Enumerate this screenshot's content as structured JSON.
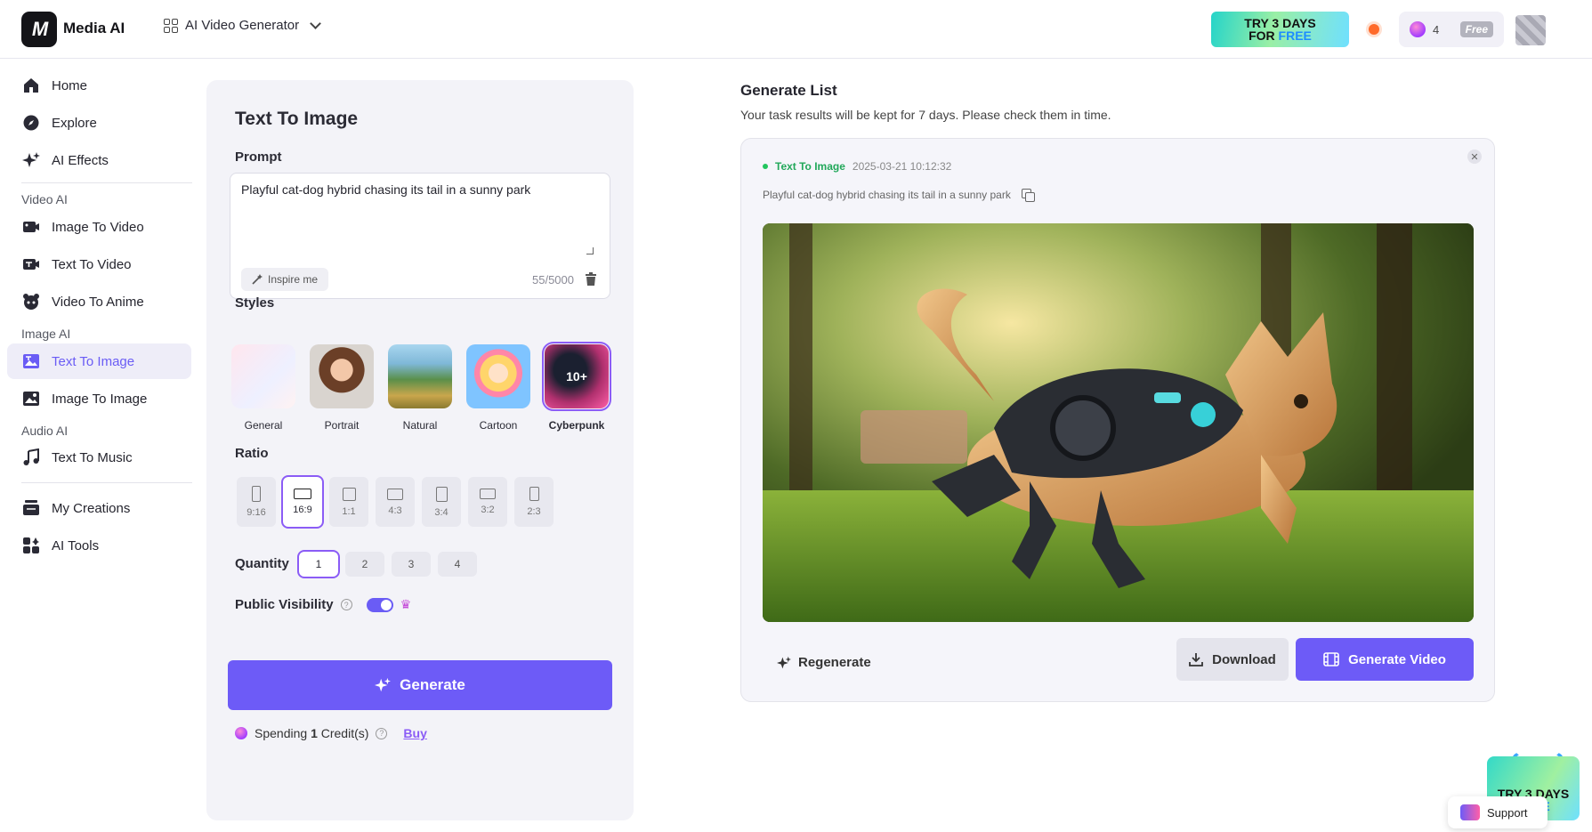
{
  "header": {
    "logo_text": "M",
    "brand": "Media AI",
    "app_switch": "AI Video Generator",
    "promo_line1": "TRY 3 DAYS",
    "promo_line2a": "FOR ",
    "promo_line2b": "FREE",
    "credits": "4",
    "free_badge": "Free"
  },
  "sidebar": {
    "items": [
      {
        "label": "Home",
        "icon": "home-icon"
      },
      {
        "label": "Explore",
        "icon": "compass-icon"
      },
      {
        "label": "AI Effects",
        "icon": "sparkle-icon"
      },
      {
        "label": "Image To Video",
        "icon": "image-video-icon"
      },
      {
        "label": "Text To Video",
        "icon": "text-video-icon"
      },
      {
        "label": "Video To Anime",
        "icon": "anime-icon"
      },
      {
        "label": "Text To Image",
        "icon": "text-image-icon",
        "active": true
      },
      {
        "label": "Image To Image",
        "icon": "image-image-icon"
      },
      {
        "label": "Text To Music",
        "icon": "music-icon"
      },
      {
        "label": "My Creations",
        "icon": "stack-icon"
      },
      {
        "label": "AI Tools",
        "icon": "tools-icon"
      }
    ],
    "sections": {
      "video_ai": "Video AI",
      "image_ai": "Image AI",
      "audio_ai": "Audio AI"
    }
  },
  "panel": {
    "title": "Text To Image",
    "prompt_label": "Prompt",
    "prompt_text": "Playful cat-dog hybrid chasing its tail in a sunny park",
    "inspire": "Inspire me",
    "counter": "55/5000",
    "styles_label": "Styles",
    "styles": [
      {
        "label": "General"
      },
      {
        "label": "Portrait"
      },
      {
        "label": "Natural"
      },
      {
        "label": "Cartoon"
      },
      {
        "label": "Cyberpunk",
        "badge": "10+",
        "selected": true
      }
    ],
    "ratio_label": "Ratio",
    "ratios": [
      "9:16",
      "16:9",
      "1:1",
      "4:3",
      "3:4",
      "3:2",
      "2:3"
    ],
    "ratio_selected": "16:9",
    "quantity_label": "Quantity",
    "quantities": [
      "1",
      "2",
      "3",
      "4"
    ],
    "quantity_selected": "1",
    "visibility_label": "Public Visibility",
    "generate": "Generate",
    "spend_prefix": "Spending",
    "spend_amount": "1",
    "spend_suffix": "Credit(s)",
    "buy": "Buy"
  },
  "generate_list": {
    "title": "Generate List",
    "subtitle": "Your task results will be kept for 7 days. Please check them in time.",
    "card": {
      "tag": "Text To Image",
      "time": "2025-03-21 10:12:32",
      "prompt": "Playful cat-dog hybrid chasing its tail in a sunny park",
      "regenerate": "Regenerate",
      "download": "Download",
      "generate_video": "Generate Video"
    }
  },
  "floaters": {
    "promo_line1": "TRY 3 DAYS",
    "promo_line2": "FREE",
    "support": "Support"
  },
  "colors": {
    "accent": "#6d5bf7",
    "success": "#22a85a",
    "selected_outline": "#8b5cf6"
  }
}
